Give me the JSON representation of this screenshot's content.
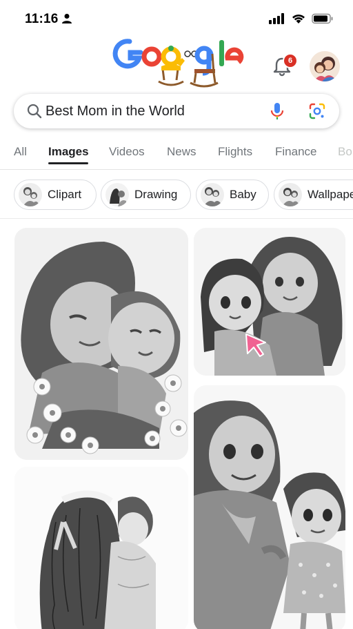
{
  "status_bar": {
    "time": "11:16"
  },
  "header": {
    "logo_alt": "Google",
    "notification_count": "6"
  },
  "search": {
    "query": "Best Mom in the World"
  },
  "tabs": [
    {
      "label": "All"
    },
    {
      "label": "Images"
    },
    {
      "label": "Videos"
    },
    {
      "label": "News"
    },
    {
      "label": "Flights"
    },
    {
      "label": "Finance"
    },
    {
      "label": "Bo"
    }
  ],
  "chips": [
    {
      "label": "Clipart"
    },
    {
      "label": "Drawing"
    },
    {
      "label": "Baby"
    },
    {
      "label": "Wallpape"
    }
  ],
  "colors": {
    "google_blue": "#4285F4",
    "google_red": "#EA4335",
    "google_yellow": "#FBBC05",
    "google_green": "#34A853",
    "badge_red": "#d93025",
    "cursor_pink": "#f06292"
  }
}
